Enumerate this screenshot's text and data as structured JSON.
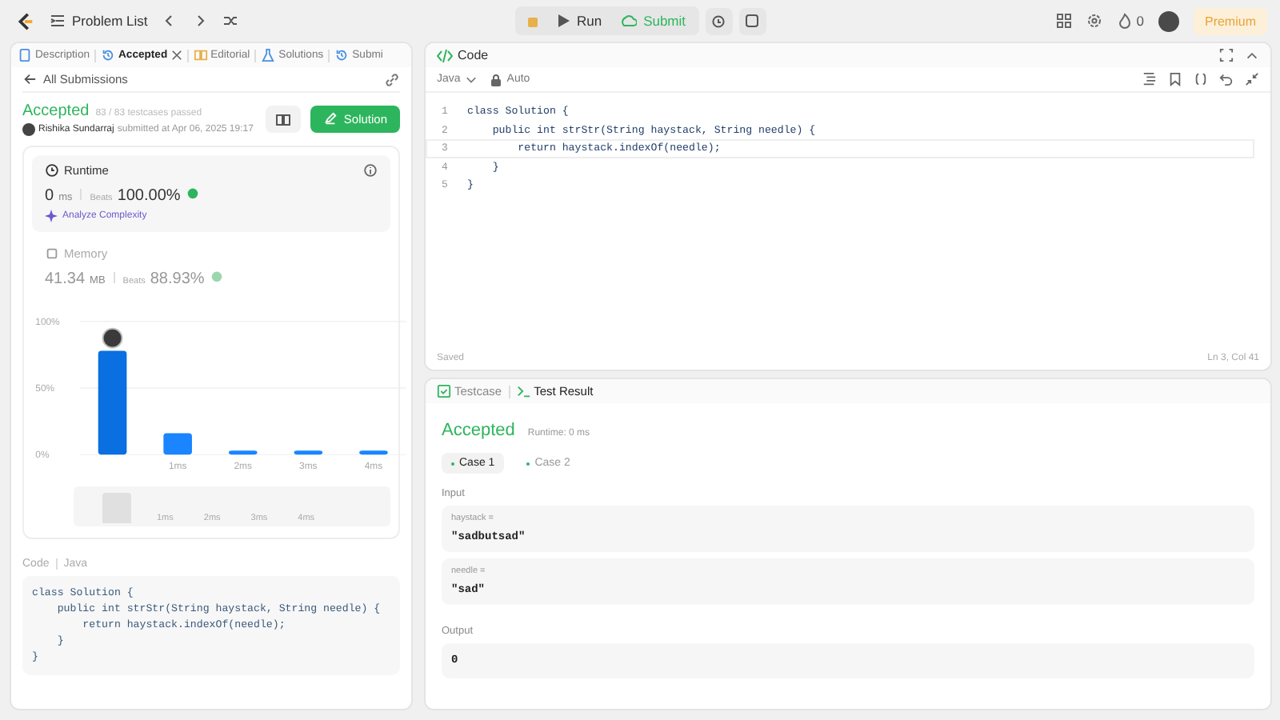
{
  "topbar": {
    "problem_list": "Problem List",
    "run": "Run",
    "submit": "Submit",
    "streak": "0",
    "premium": "Premium"
  },
  "left_tabs": [
    {
      "label": "Description",
      "selected": false,
      "closable": false
    },
    {
      "label": "Accepted",
      "selected": true,
      "closable": true
    },
    {
      "label": "Editorial",
      "selected": false,
      "closable": false
    },
    {
      "label": "Solutions",
      "selected": false,
      "closable": false
    },
    {
      "label": "Submi",
      "selected": false,
      "closable": false
    }
  ],
  "submission": {
    "back": "All Submissions",
    "status": "Accepted",
    "passed": "83 / 83 testcases passed",
    "user": "Rishika Sundarraj",
    "submitted": "submitted at Apr 06, 2025 19:17",
    "solution_button": "Solution"
  },
  "runtime": {
    "title": "Runtime",
    "value": "0",
    "unit": "ms",
    "beats_label": "Beats",
    "beats": "100.00%",
    "analyze": "Analyze Complexity"
  },
  "memory": {
    "title": "Memory",
    "value": "41.34",
    "unit": "MB",
    "beats_label": "Beats",
    "beats": "88.93%"
  },
  "distribution": {
    "chart_data": {
      "type": "bar",
      "categories": [
        null,
        "1ms",
        "2ms",
        "3ms",
        "4ms"
      ],
      "values": [
        78,
        16,
        3,
        3,
        3
      ],
      "ylim": [
        0,
        100
      ],
      "yticks": [
        {
          "value": 0,
          "label": "0%"
        },
        {
          "value": 50,
          "label": "50%"
        },
        {
          "value": 100,
          "label": "100%"
        }
      ]
    },
    "overview_labels": [
      "1ms",
      "2ms",
      "3ms",
      "4ms"
    ]
  },
  "submitted_code": {
    "label": "Code",
    "language": "Java",
    "lines": [
      "class Solution {",
      "    public int strStr(String haystack, String needle) {",
      "        return haystack.indexOf(needle);",
      "    }",
      "}"
    ]
  },
  "editor": {
    "title": "Code",
    "language": "Java",
    "mode": "Auto",
    "lines": [
      {
        "number": "1",
        "text": "class Solution {",
        "current": false
      },
      {
        "number": "2",
        "text": "    public int strStr(String haystack, String needle) {",
        "current": false
      },
      {
        "number": "3",
        "text": "        return haystack.indexOf(needle);",
        "current": true
      },
      {
        "number": "4",
        "text": "    }",
        "current": false
      },
      {
        "number": "5",
        "text": "}",
        "current": false
      }
    ],
    "status": "Saved",
    "cursor": "Ln 3, Col 41"
  },
  "result_tabs": [
    {
      "label": "Testcase",
      "selected": false
    },
    {
      "label": "Test Result",
      "selected": true
    }
  ],
  "result": {
    "status": "Accepted",
    "runtime": "Runtime: 0 ms",
    "cases": [
      {
        "label": "Case 1",
        "selected": true
      },
      {
        "label": "Case 2",
        "selected": false
      }
    ],
    "input_label": "Input",
    "inputs": [
      {
        "name": "haystack =",
        "value": "\"sadbutsad\""
      },
      {
        "name": "needle =",
        "value": "\"sad\""
      }
    ],
    "output_label": "Output",
    "output": "0"
  }
}
